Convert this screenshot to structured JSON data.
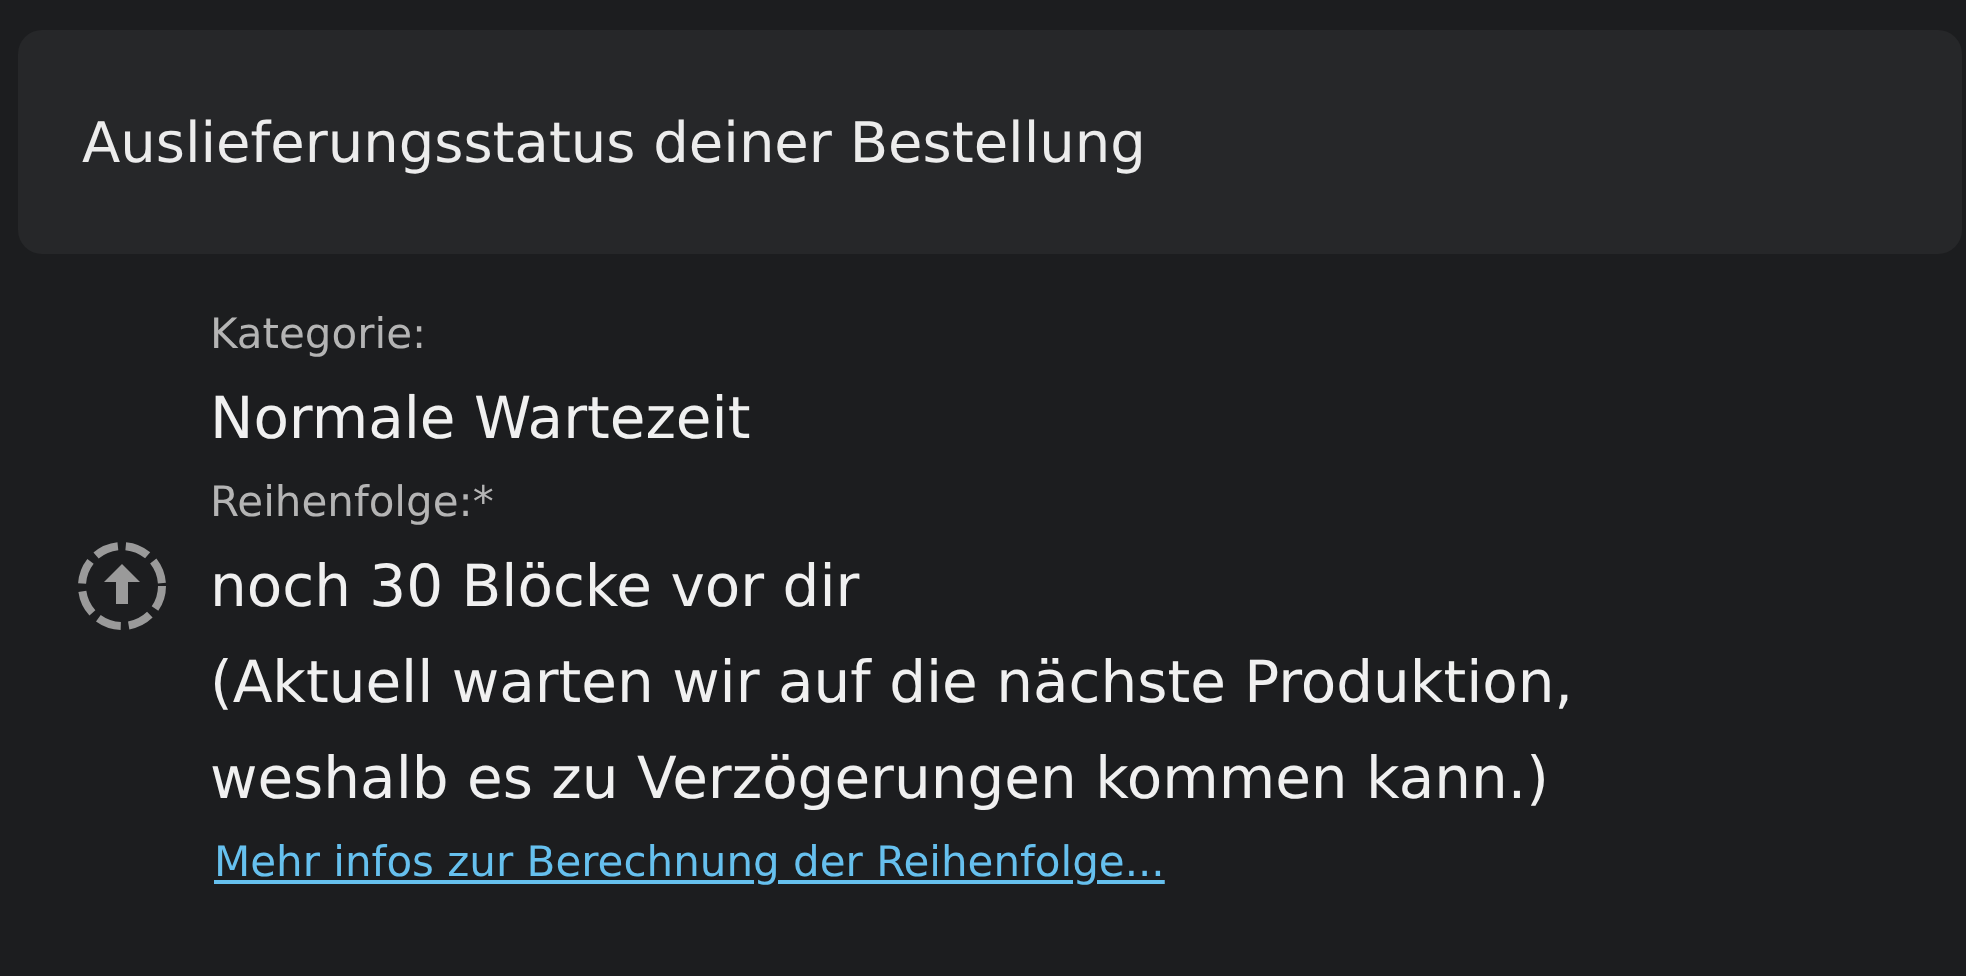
{
  "header": {
    "title": "Auslieferungsstatus deiner Bestellung"
  },
  "details": [
    {
      "label": "Kategorie:",
      "lines": [
        "Normale Wartezeit"
      ]
    },
    {
      "label": "Reihenfolge:*",
      "lines": [
        "noch 30 Blöcke vor dir",
        "(Aktuell warten wir auf die nächste Produktion,",
        "weshalb es zu Verzögerungen kommen kann.)"
      ],
      "icon": true
    }
  ],
  "link": "Mehr infos zur Berechnung der Reihenfolge..."
}
